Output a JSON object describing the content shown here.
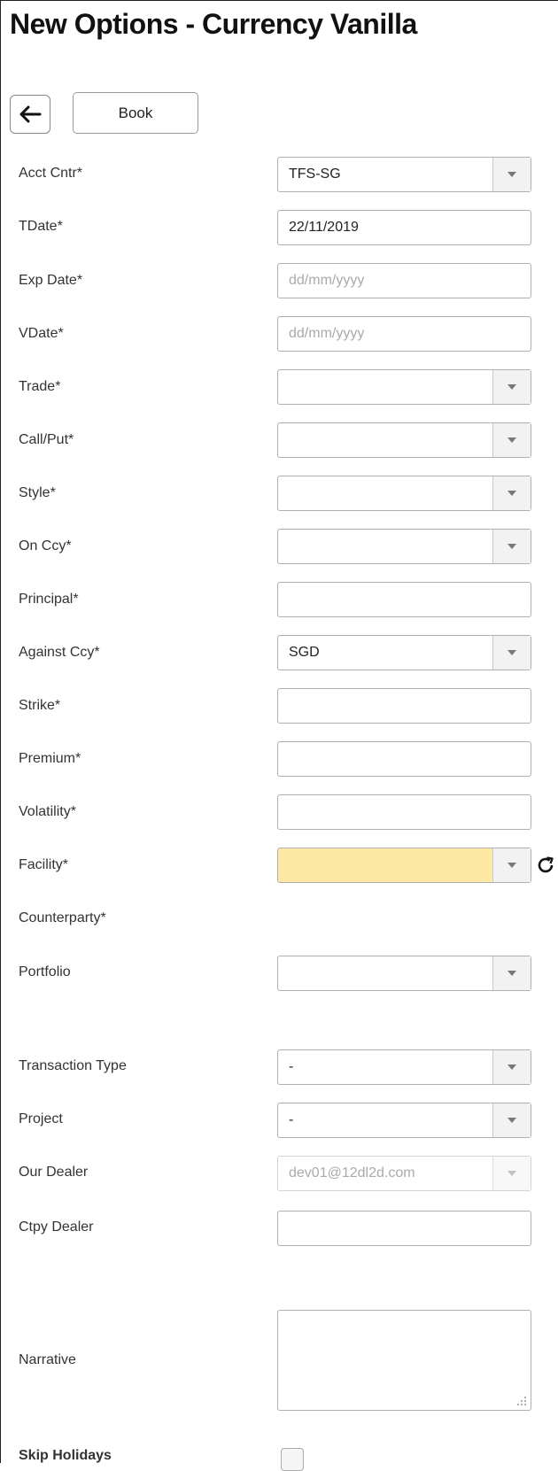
{
  "title": "New Options - Currency Vanilla",
  "toolbar": {
    "back_icon": "arrow-left-icon",
    "book_label": "Book"
  },
  "fields": {
    "acct_cntr": {
      "label": "Acct Cntr*",
      "value": "TFS-SG"
    },
    "tdate": {
      "label": "TDate*",
      "value": "22/11/2019"
    },
    "exp_date": {
      "label": "Exp Date*",
      "placeholder": "dd/mm/yyyy"
    },
    "vdate": {
      "label": "VDate*",
      "placeholder": "dd/mm/yyyy"
    },
    "trade": {
      "label": "Trade*",
      "value": ""
    },
    "call_put": {
      "label": "Call/Put*",
      "value": ""
    },
    "style": {
      "label": "Style*",
      "value": ""
    },
    "on_ccy": {
      "label": "On Ccy*",
      "value": ""
    },
    "principal": {
      "label": "Principal*",
      "value": ""
    },
    "against_ccy": {
      "label": "Against Ccy*",
      "value": "SGD"
    },
    "strike": {
      "label": "Strike*",
      "value": ""
    },
    "premium": {
      "label": "Premium*",
      "value": ""
    },
    "volatility": {
      "label": "Volatility*",
      "value": ""
    },
    "facility": {
      "label": "Facility*",
      "value": "",
      "highlight_color": "#fde9a3",
      "refresh_icon": "refresh-icon"
    },
    "counterparty": {
      "label": "Counterparty*"
    },
    "portfolio": {
      "label": "Portfolio",
      "value": ""
    },
    "transaction_type": {
      "label": "Transaction Type",
      "value": "-"
    },
    "project": {
      "label": "Project",
      "value": "-"
    },
    "our_dealer": {
      "label": "Our Dealer",
      "value": "dev01@12dl2d.com",
      "disabled": true
    },
    "ctpy_dealer": {
      "label": "Ctpy Dealer",
      "value": ""
    },
    "narrative": {
      "label": "Narrative",
      "value": ""
    },
    "skip_holidays": {
      "label": "Skip Holidays",
      "checked": false
    }
  }
}
